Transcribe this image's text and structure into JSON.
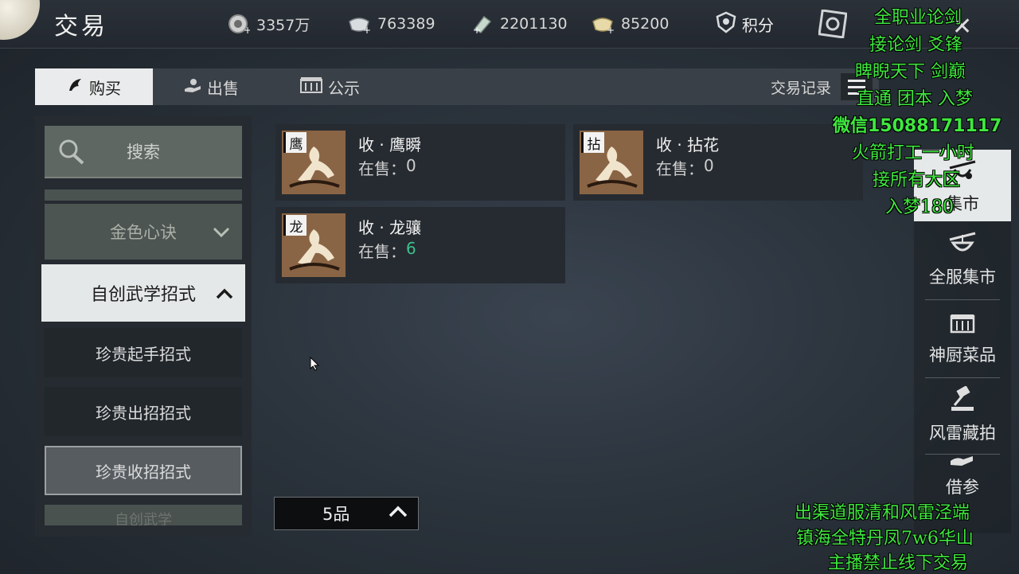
{
  "header": {
    "title": "交易",
    "currencies": [
      {
        "icon": "coin-pouch-icon",
        "value": "3357万"
      },
      {
        "icon": "silver-ingot-icon",
        "value": "763389"
      },
      {
        "icon": "jade-icon",
        "value": "2201130"
      },
      {
        "icon": "gold-ingot-icon",
        "value": "85200"
      }
    ],
    "points_label": "积分"
  },
  "tabs": {
    "buy": "购买",
    "sell": "出售",
    "notice": "公示",
    "records": "交易记录"
  },
  "left": {
    "search": "搜索",
    "gold_category": "金色心诀",
    "active_category": "自创武学招式",
    "subitems": [
      "珍贵起手招式",
      "珍贵出招招式",
      "珍贵收招招式"
    ],
    "partial_category": "自创武学"
  },
  "items": [
    {
      "tag": "鹰",
      "name": "收 · 鹰瞬",
      "sale_label": "在售：",
      "count": "0"
    },
    {
      "tag": "拈",
      "name": "收 · 拈花",
      "sale_label": "在售：",
      "count": "0"
    },
    {
      "tag": "龙",
      "name": "收 · 龙骧",
      "sale_label": "在售：",
      "count": "6"
    }
  ],
  "quality": "5品",
  "rightbar": [
    {
      "icon": "market-stall-icon",
      "label": "集市"
    },
    {
      "icon": "server-market-icon",
      "label": "全服集市"
    },
    {
      "icon": "chef-stall-icon",
      "label": "神厨菜品"
    },
    {
      "icon": "auction-hammer-icon",
      "label": "风雷藏拍"
    },
    {
      "icon": "hand-icon",
      "label": "借参"
    }
  ],
  "overlay": {
    "top_lines": [
      "全职业论剑",
      "接论剑 爻锋",
      "睥睨天下  剑巅",
      "直通 团本 入梦",
      "微信15088171117",
      "火箭打工一小时",
      "接所有大区",
      "入梦180"
    ],
    "bottom_lines": [
      "出渠道服清和风雷泾端",
      "镇海全特丹凤7w6华山",
      "主播禁止线下交易"
    ]
  },
  "colors": {
    "accent_green": "#3fbf8d",
    "overlay_green": "#3fe73f",
    "active_tab": "#e9ebec"
  }
}
